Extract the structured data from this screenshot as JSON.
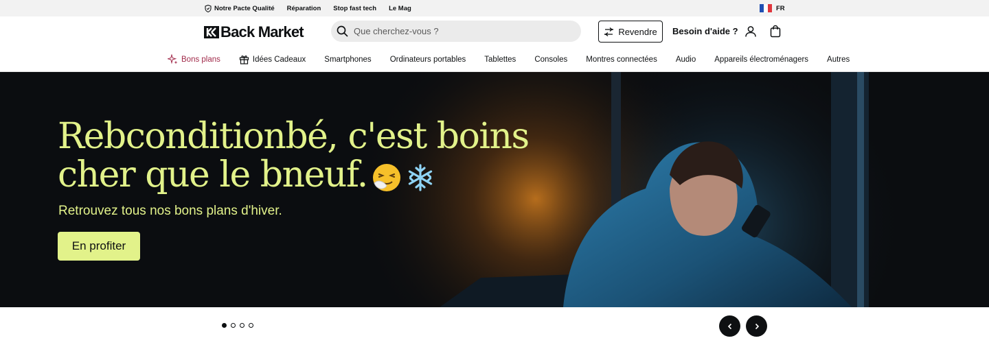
{
  "topbar": {
    "links": [
      "Notre Pacte Qualité",
      "Réparation",
      "Stop fast tech",
      "Le Mag"
    ],
    "lang": "FR"
  },
  "header": {
    "logo": "Back Market",
    "search_placeholder": "Que cherchez-vous ?",
    "sell_label": "Revendre",
    "help_label": "Besoin d'aide ?"
  },
  "nav": {
    "items": [
      "Bons plans",
      "Idées Cadeaux",
      "Smartphones",
      "Ordinateurs portables",
      "Tablettes",
      "Consoles",
      "Montres connectées",
      "Audio",
      "Appareils électroménagers",
      "Autres"
    ]
  },
  "hero": {
    "title_line1": "Rebconditionbé, c'est boins",
    "title_line2": "cher que le bneuf.",
    "subtitle": "Retrouvez tous nos bons plans d'hiver.",
    "cta_label": "En profiter"
  },
  "carousel": {
    "slide_count": 4,
    "active_index": 0
  },
  "colors": {
    "accent": "#e2f28a",
    "deals": "#a12a4a",
    "dark": "#0e1012"
  }
}
